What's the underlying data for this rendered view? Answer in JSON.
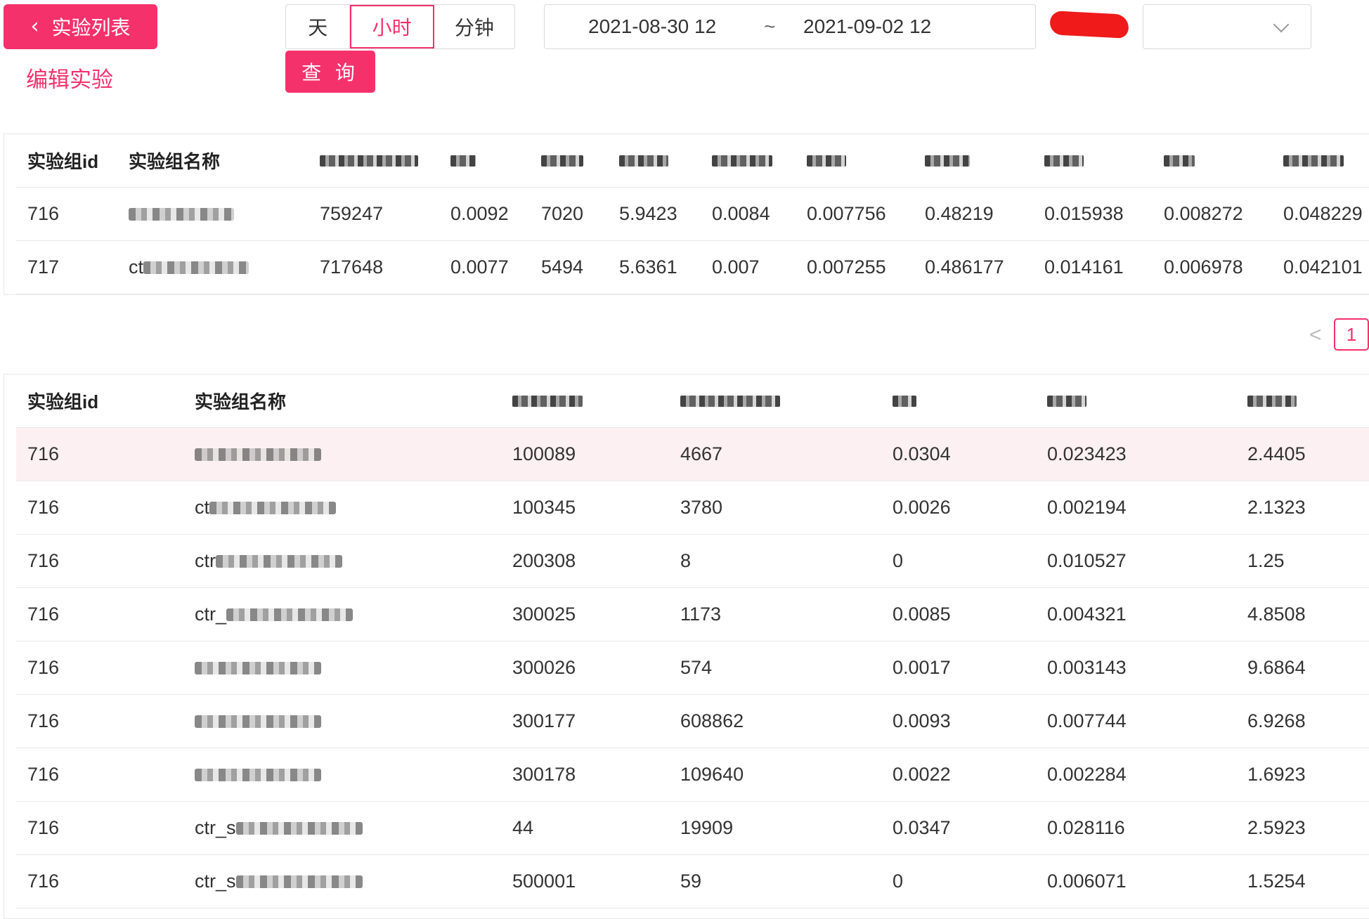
{
  "toolbar": {
    "back_label": "实验列表",
    "edit_label": "编辑实验",
    "granularity": {
      "options": [
        "天",
        "小时",
        "分钟"
      ],
      "selected": "小时"
    },
    "query_label": "查 询",
    "date_range": {
      "start": "2021-08-30 12",
      "separator": "~",
      "end": "2021-09-02 12"
    },
    "select_value": ""
  },
  "summary_table": {
    "headers": [
      "实验组id",
      "实验组名称"
    ],
    "rows": [
      {
        "id": "716",
        "name_prefix": "",
        "values": [
          "759247",
          "0.0092",
          "7020",
          "5.9423",
          "0.0084",
          "0.007756",
          "0.48219",
          "0.015938",
          "0.008272",
          "0.048229"
        ]
      },
      {
        "id": "717",
        "name_prefix": "ct",
        "values": [
          "717648",
          "0.0077",
          "5494",
          "5.6361",
          "0.007",
          "0.007255",
          "0.486177",
          "0.014161",
          "0.006978",
          "0.042101"
        ]
      }
    ]
  },
  "pagination": {
    "prev": "<",
    "current": "1"
  },
  "detail_table": {
    "headers": [
      "实验组id",
      "实验组名称"
    ],
    "rows": [
      {
        "id": "716",
        "name_prefix": "",
        "values": [
          "100089",
          "4667",
          "0.0304",
          "0.023423",
          "2.4405"
        ],
        "highlighted": true
      },
      {
        "id": "716",
        "name_prefix": "ct",
        "values": [
          "100345",
          "3780",
          "0.0026",
          "0.002194",
          "2.1323"
        ],
        "highlighted": false
      },
      {
        "id": "716",
        "name_prefix": "ctr",
        "values": [
          "200308",
          "8",
          "0",
          "0.010527",
          "1.25"
        ],
        "highlighted": false
      },
      {
        "id": "716",
        "name_prefix": "ctr_",
        "values": [
          "300025",
          "1173",
          "0.0085",
          "0.004321",
          "4.8508"
        ],
        "highlighted": false
      },
      {
        "id": "716",
        "name_prefix": "",
        "values": [
          "300026",
          "574",
          "0.0017",
          "0.003143",
          "9.6864"
        ],
        "highlighted": false
      },
      {
        "id": "716",
        "name_prefix": "",
        "values": [
          "300177",
          "608862",
          "0.0093",
          "0.007744",
          "6.9268"
        ],
        "highlighted": false
      },
      {
        "id": "716",
        "name_prefix": "",
        "values": [
          "300178",
          "109640",
          "0.0022",
          "0.002284",
          "1.6923"
        ],
        "highlighted": false
      },
      {
        "id": "716",
        "name_prefix": "ctr_s",
        "values": [
          "44",
          "19909",
          "0.0347",
          "0.028116",
          "2.5923"
        ],
        "highlighted": false
      },
      {
        "id": "716",
        "name_prefix": "ctr_s",
        "values": [
          "500001",
          "59",
          "0",
          "0.006071",
          "1.5254"
        ],
        "highlighted": false
      }
    ]
  },
  "colors": {
    "accent": "#f5316b",
    "highlight_row": "#fdf0f2",
    "border": "#e8e8e8"
  }
}
